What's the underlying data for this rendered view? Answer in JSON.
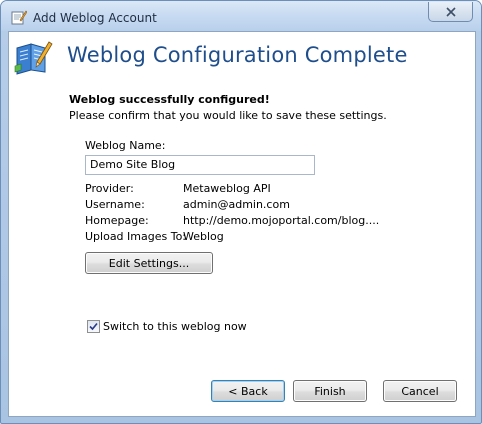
{
  "window": {
    "title": "Add Weblog Account"
  },
  "header": {
    "title": "Weblog Configuration Complete"
  },
  "content": {
    "success_heading": "Weblog successfully configured!",
    "confirm_text": "Please confirm that you would like to save these settings.",
    "weblog_name_label": "Weblog Name:",
    "weblog_name_value": "Demo Site Blog",
    "details": [
      {
        "label": "Provider:",
        "value": "Metaweblog API"
      },
      {
        "label": "Username:",
        "value": "admin@admin.com"
      },
      {
        "label": "Homepage:",
        "value": "http://demo.mojoportal.com/blog...."
      },
      {
        "label": "Upload Images To:",
        "value": "Weblog"
      }
    ],
    "edit_settings_label": "Edit Settings...",
    "switch_checkbox_label": "Switch to this weblog now",
    "switch_checked": true
  },
  "footer": {
    "back_label": "< Back",
    "finish_label": "Finish",
    "cancel_label": "Cancel"
  },
  "colors": {
    "header_title": "#1f4e8c",
    "window_frame": "#a9c3e3",
    "default_button_border": "#3c7fb1"
  }
}
